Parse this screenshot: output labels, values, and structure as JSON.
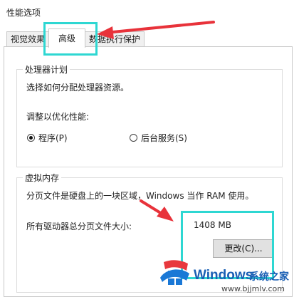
{
  "window": {
    "title": "性能选项"
  },
  "tabs": [
    {
      "label": "视觉效果"
    },
    {
      "label": "高级"
    },
    {
      "label": "数据执行保护"
    }
  ],
  "processor": {
    "title": "处理器计划",
    "description": "选择如何分配处理器资源。",
    "optimize_label": "调整以优化性能:",
    "options": [
      {
        "label": "程序(P)",
        "checked": true
      },
      {
        "label": "后台服务(S)",
        "checked": false
      }
    ]
  },
  "virtual_memory": {
    "title": "虚拟内存",
    "description": "分页文件是硬盘上的一块区域，Windows 当作 RAM 使用。",
    "total_label": "所有驱动器总分页文件大小:",
    "total_value": "1408 MB",
    "change_button": "更改(C)..."
  },
  "watermark": {
    "brand": "Windows",
    "site_name": "系统之家",
    "url": "www.bjjmlv.com"
  },
  "colors": {
    "highlight": "#2ed7d2",
    "arrow": "#e8323a",
    "logo_blue": "#1a78d6",
    "logo_red": "#e8383d"
  }
}
